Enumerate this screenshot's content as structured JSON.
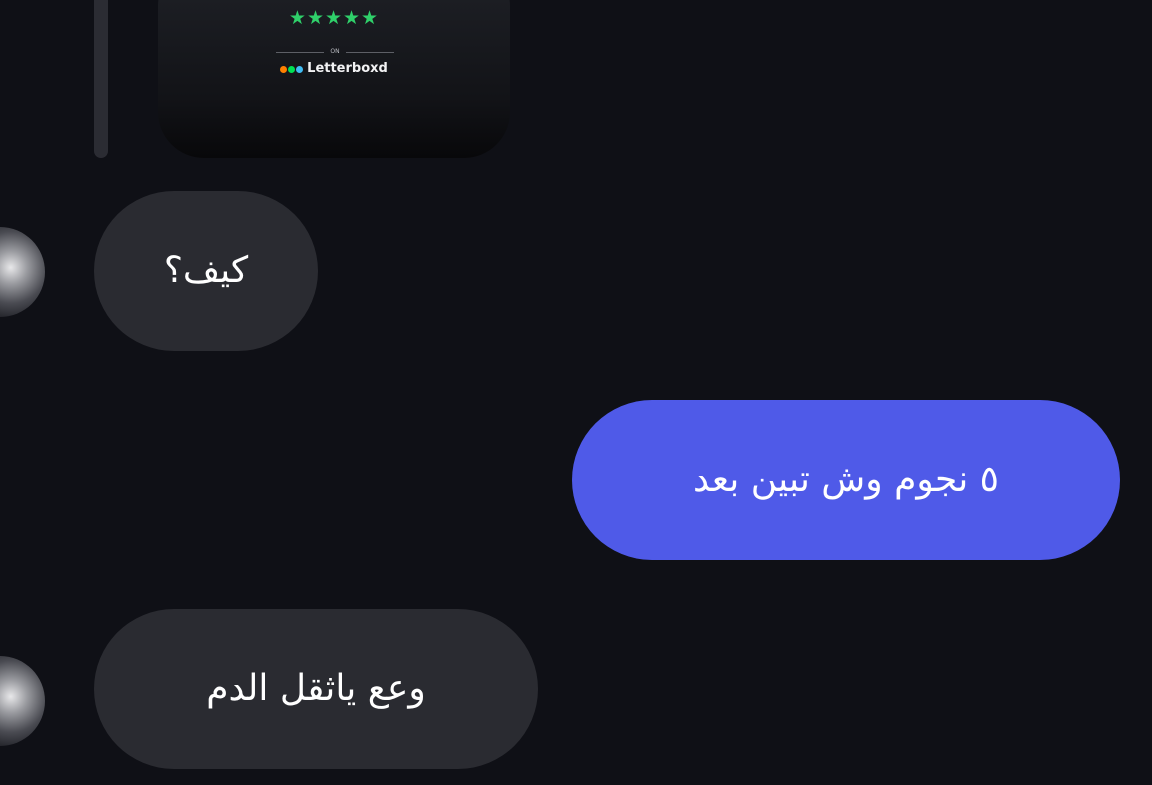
{
  "shared_card": {
    "rating_stars": "★★★★★",
    "on_label": "ON",
    "brand_name": "Letterboxd",
    "brand_dot_colors": [
      "#ff8000",
      "#00e054",
      "#40bcf4"
    ],
    "star_color": "#2fd06a"
  },
  "messages": [
    {
      "direction": "incoming",
      "text": "كيف؟",
      "has_avatar": true
    },
    {
      "direction": "outgoing",
      "text": "٥ نجوم وش تبين بعد",
      "has_avatar": false
    },
    {
      "direction": "incoming",
      "text": "وعع ياثقل الدم",
      "has_avatar": true
    }
  ],
  "colors": {
    "background": "#0f1016",
    "incoming_bubble": "#2a2b31",
    "outgoing_bubble": "#4f5ae8",
    "text": "#ffffff"
  },
  "icons": {
    "avatar": "avatar-photo"
  }
}
